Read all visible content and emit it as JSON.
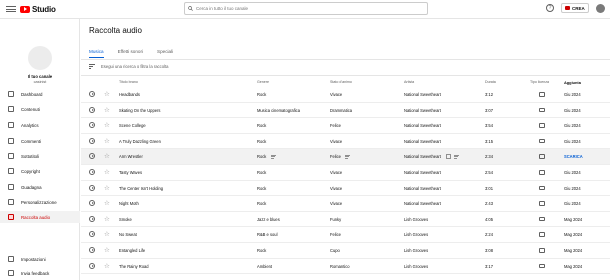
{
  "app": {
    "name": "Studio",
    "search_placeholder": "Cerca in tutto il tuo canale",
    "create_label": "CREA",
    "help_glyph": "?"
  },
  "channel": {
    "label": "Il tuo canale",
    "name": "casinist"
  },
  "nav": [
    {
      "label": "Dashboard",
      "name": "sidebar-item-dashboard"
    },
    {
      "label": "Contenuti",
      "name": "sidebar-item-contenuti"
    },
    {
      "label": "Analytics",
      "name": "sidebar-item-analytics"
    },
    {
      "label": "Commenti",
      "name": "sidebar-item-commenti"
    },
    {
      "label": "Sottotitoli",
      "name": "sidebar-item-sottotitoli"
    },
    {
      "label": "Copyright",
      "name": "sidebar-item-copyright"
    },
    {
      "label": "Guadagna",
      "name": "sidebar-item-guadagna"
    },
    {
      "label": "Personalizzazione",
      "name": "sidebar-item-personalizzazione"
    },
    {
      "label": "Raccolta audio",
      "name": "sidebar-item-raccolta-audio",
      "active": true
    }
  ],
  "nav_bottom": [
    {
      "label": "Impostazioni"
    },
    {
      "label": "Invia feedback"
    }
  ],
  "page": {
    "title": "Raccolta audio"
  },
  "tabs": [
    {
      "label": "Musica",
      "active": true
    },
    {
      "label": "Effetti sonori"
    },
    {
      "label": "Speciali"
    }
  ],
  "filter": {
    "placeholder": "Esegui una ricerca o filtra la raccolta"
  },
  "columns": {
    "title": "Titolo brano",
    "genre": "Genere",
    "mood": "Stato d'animo",
    "artist": "Artista",
    "duration": "Durata",
    "license": "Tipo licenza",
    "added": "Aggiunta"
  },
  "tracks": [
    {
      "title": "Headbands",
      "genre": "Rock",
      "mood": "Vivace",
      "artist": "National Sweetheart",
      "duration": "3:12",
      "added": "Giu 2024"
    },
    {
      "title": "Skating On the Uppers",
      "genre": "Musica cinematografica",
      "mood": "Drammatica",
      "artist": "National Sweetheart",
      "duration": "3:07",
      "added": "Giu 2024"
    },
    {
      "title": "Scene College",
      "genre": "Rock",
      "mood": "Felice",
      "artist": "National Sweetheart",
      "duration": "3:54",
      "added": "Giu 2024"
    },
    {
      "title": "A Truly Dazzling Green",
      "genre": "Rock",
      "mood": "Vivace",
      "artist": "National Sweetheart",
      "duration": "3:15",
      "added": "Giu 2024"
    },
    {
      "title": "Arm Wrestler",
      "genre": "Rock",
      "mood": "Felice",
      "artist": "National Sweetheart",
      "duration": "2:34",
      "added": "SCARICA",
      "hover": true
    },
    {
      "title": "Tasty Waves",
      "genre": "Rock",
      "mood": "Vivace",
      "artist": "National Sweetheart",
      "duration": "2:54",
      "added": "Giu 2024"
    },
    {
      "title": "The Center Isn't Holding",
      "genre": "Rock",
      "mood": "Vivace",
      "artist": "National Sweetheart",
      "duration": "3:01",
      "added": "Giu 2024"
    },
    {
      "title": "Night Moth",
      "genre": "Rock",
      "mood": "Vivace",
      "artist": "National Sweetheart",
      "duration": "2:43",
      "added": "Giu 2024"
    },
    {
      "title": "Smoke",
      "genre": "Jazz e blues",
      "mood": "Funky",
      "artist": "Lish Grooves",
      "duration": "4:05",
      "added": "Mag 2024"
    },
    {
      "title": "No Sweat",
      "genre": "R&B e soul",
      "mood": "Felice",
      "artist": "Lish Grooves",
      "duration": "2:24",
      "added": "Mag 2024"
    },
    {
      "title": "Entangled Life",
      "genre": "Rock",
      "mood": "Cupo",
      "artist": "Lish Grooves",
      "duration": "3:08",
      "added": "Mag 2024"
    },
    {
      "title": "The Rainy Road",
      "genre": "Ambient",
      "mood": "Romantico",
      "artist": "Lish Grooves",
      "duration": "3:17",
      "added": "Mag 2024"
    }
  ]
}
